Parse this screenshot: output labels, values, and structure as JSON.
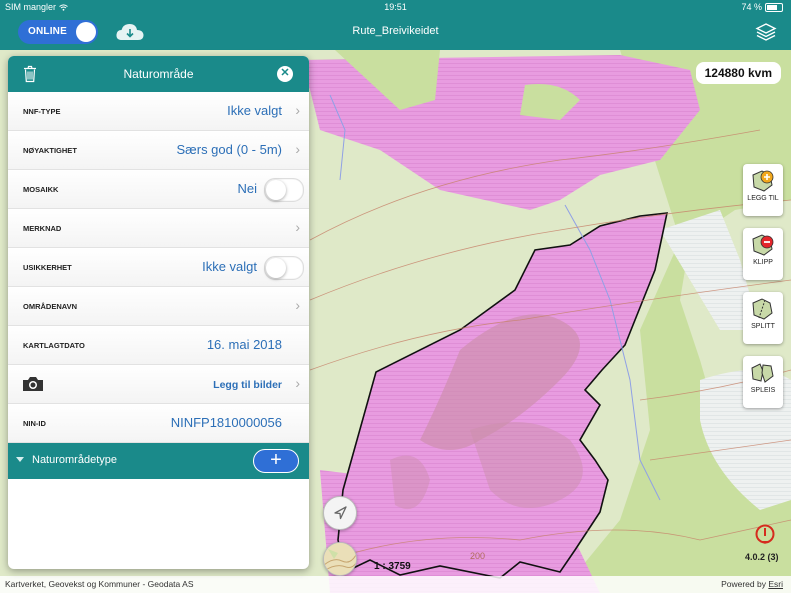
{
  "status_bar": {
    "carrier": "SIM mangler",
    "time": "19:51",
    "battery": "74 %",
    "battery_level": 0.74
  },
  "nav": {
    "online_label": "ONLINE",
    "title": "Rute_Breivikeidet",
    "cloud_icon": "cloud-download-icon",
    "layers_icon": "layers-icon"
  },
  "map": {
    "area": "124880 kvm",
    "scale": "1 : 3759",
    "contour_label": "200",
    "version": "4.0.2 (3)",
    "attribution": "Kartverket, Geovekst og Kommuner - Geodata AS",
    "powered_by": "Powered by",
    "powered_by_link": "Esri",
    "colors": {
      "polygon": "#e89ce0",
      "forest": "#d5e7b0",
      "open": "#eef1f0",
      "outline": "#000000"
    },
    "tools": [
      {
        "label": "LEGG TIL",
        "icon": "add-area-icon"
      },
      {
        "label": "KLIPP",
        "icon": "cut-area-icon"
      },
      {
        "label": "SPLITT",
        "icon": "split-area-icon"
      },
      {
        "label": "SPLEIS",
        "icon": "merge-area-icon"
      }
    ]
  },
  "panel": {
    "title": "Naturområde",
    "rows": [
      {
        "key": "NNF-TYPE",
        "value": "Ikke valgt",
        "kind": "chevron"
      },
      {
        "key": "NØYAKTIGHET",
        "value": "Særs god (0 - 5m)",
        "kind": "chevron"
      },
      {
        "key": "MOSAIKK",
        "value": "Nei",
        "kind": "switch"
      },
      {
        "key": "MERKNAD",
        "value": "",
        "kind": "chevron"
      },
      {
        "key": "USIKKERHET",
        "value": "Ikke valgt",
        "kind": "switch"
      },
      {
        "key": "OMRÅDENAVN",
        "value": "",
        "kind": "chevron"
      },
      {
        "key": "KARTLAGTDATO",
        "value": "16. mai 2018",
        "kind": "plain"
      },
      {
        "key": "",
        "value": "Legg til bilder",
        "kind": "camera"
      },
      {
        "key": "NIN-ID",
        "value": "NINFP1810000056",
        "kind": "plain"
      }
    ],
    "section_label": "Naturområdetype",
    "section_add": "+"
  }
}
